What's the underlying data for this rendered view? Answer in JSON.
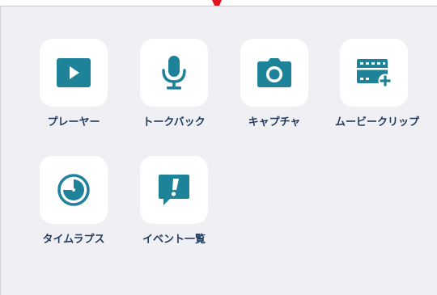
{
  "colors": {
    "panel_bg": "#efeff4",
    "tile_bg": "#ffffff",
    "icon_teal": "#1e8399",
    "label_navy": "#1f3a5c",
    "pointer_red": "#e0161f"
  },
  "pointer": {
    "icon": "caret-down-indicator"
  },
  "tiles": [
    {
      "label": "プレーヤー",
      "icon": "play-icon"
    },
    {
      "label": "トークバック",
      "icon": "microphone-icon"
    },
    {
      "label": "キャプチャ",
      "icon": "camera-icon"
    },
    {
      "label": "ムービークリップ",
      "icon": "film-add-icon"
    },
    {
      "label": "タイムラプス",
      "icon": "timelapse-icon"
    },
    {
      "label": "イベント一覧",
      "icon": "event-alert-icon"
    }
  ]
}
